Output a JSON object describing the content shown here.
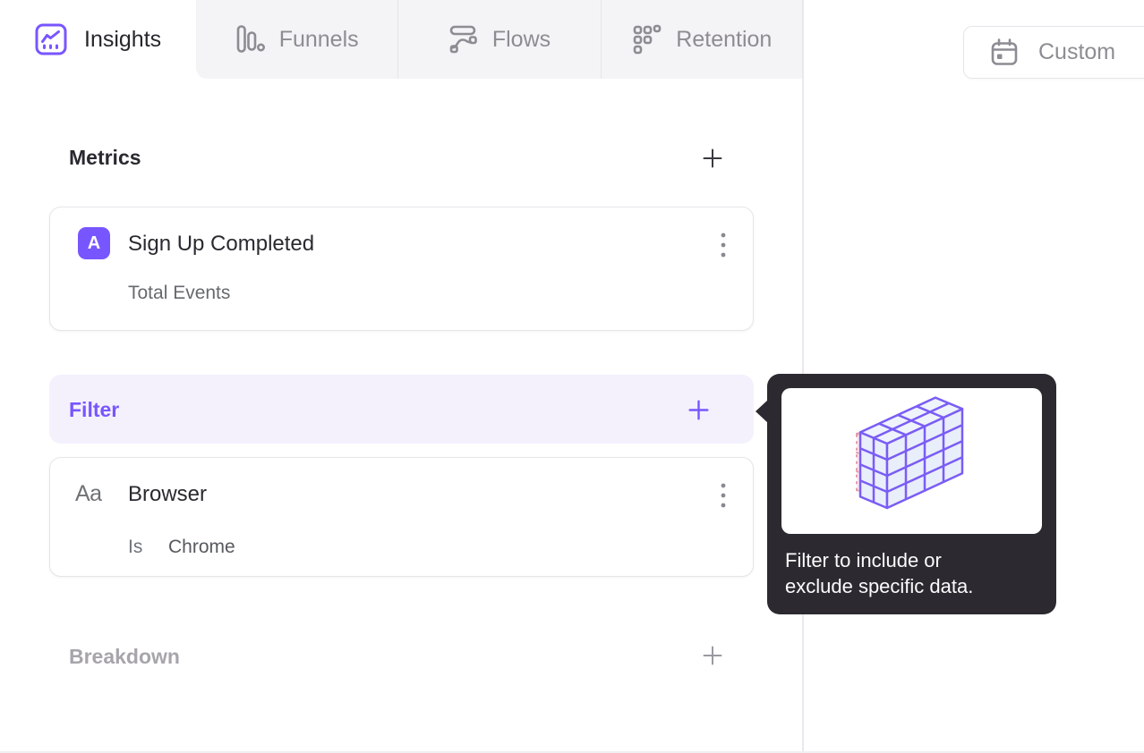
{
  "colors": {
    "accent_purple": "#7856FF",
    "tab_inactive_bg": "#F4F3F5",
    "tooltip_bg": "#2C2A30",
    "filter_row_bg": "#F4F1FD",
    "card_border": "#E6E5E8"
  },
  "tabs": [
    {
      "label": "Insights",
      "icon": "insights-chart-icon",
      "active": true
    },
    {
      "label": "Funnels",
      "icon": "funnels-bars-icon",
      "active": false
    },
    {
      "label": "Flows",
      "icon": "flows-wave-icon",
      "active": false
    },
    {
      "label": "Retention",
      "icon": "retention-dots-icon",
      "active": false
    }
  ],
  "toolbar": {
    "date_button_label": "Custom",
    "date_button_icon": "calendar-icon"
  },
  "builder": {
    "metrics": {
      "heading": "Metrics"
    },
    "metric_card": {
      "badge": "A",
      "title": "Sign Up Completed",
      "subtitle": "Total Events"
    },
    "filter": {
      "heading": "Filter"
    },
    "filter_card": {
      "type_icon_label": "Aa",
      "title": "Browser",
      "operator": "Is",
      "value": "Chrome"
    },
    "breakdown": {
      "heading": "Breakdown"
    }
  },
  "tooltip": {
    "text": "Filter to include or exclude specific data.",
    "illustration": "filter-cube-illustration"
  }
}
